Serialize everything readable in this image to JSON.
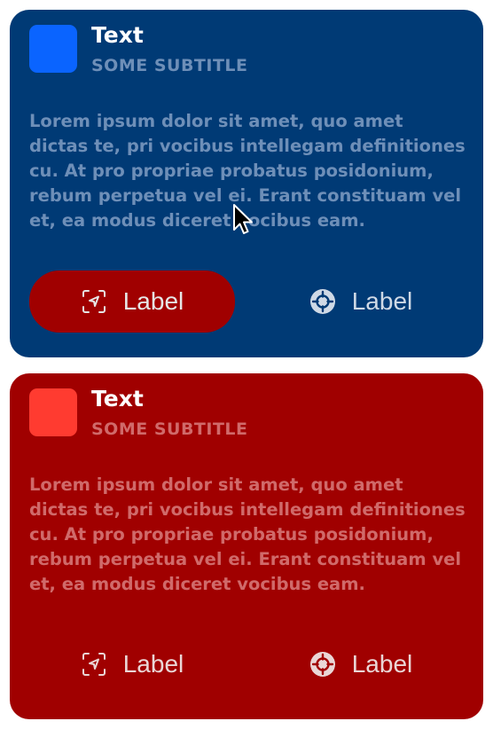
{
  "cards": [
    {
      "theme": "blue",
      "title": "Text",
      "subtitle": "SOME SUBTITLE",
      "body": "Lorem ipsum dolor sit amet, quo amet dictas te, pri vocibus intellegam definitiones cu. At pro propriae probatus posidonium, rebum perpetua vel ei. Erant constituam vel et, ea modus diceret vocibus eam.",
      "primary_button": {
        "label": "Label",
        "icon": "location-scan-icon"
      },
      "secondary_button": {
        "label": "Label",
        "icon": "crosshair-circle-icon"
      }
    },
    {
      "theme": "red",
      "title": "Text",
      "subtitle": "SOME SUBTITLE",
      "body": "Lorem ipsum dolor sit amet, quo amet dictas te, pri vocibus intellegam definitiones cu. At pro propriae probatus posidonium, rebum perpetua vel ei. Erant constituam vel et, ea modus diceret vocibus eam.",
      "primary_button": {
        "label": "Label",
        "icon": "location-scan-icon"
      },
      "secondary_button": {
        "label": "Label",
        "icon": "crosshair-circle-icon"
      }
    }
  ],
  "colors": {
    "blue_card": "#003a75",
    "red_card": "#a00000",
    "blue_avatar": "#0a64ff",
    "red_avatar": "#ff3b30",
    "primary_button_fill": "#a00000"
  }
}
